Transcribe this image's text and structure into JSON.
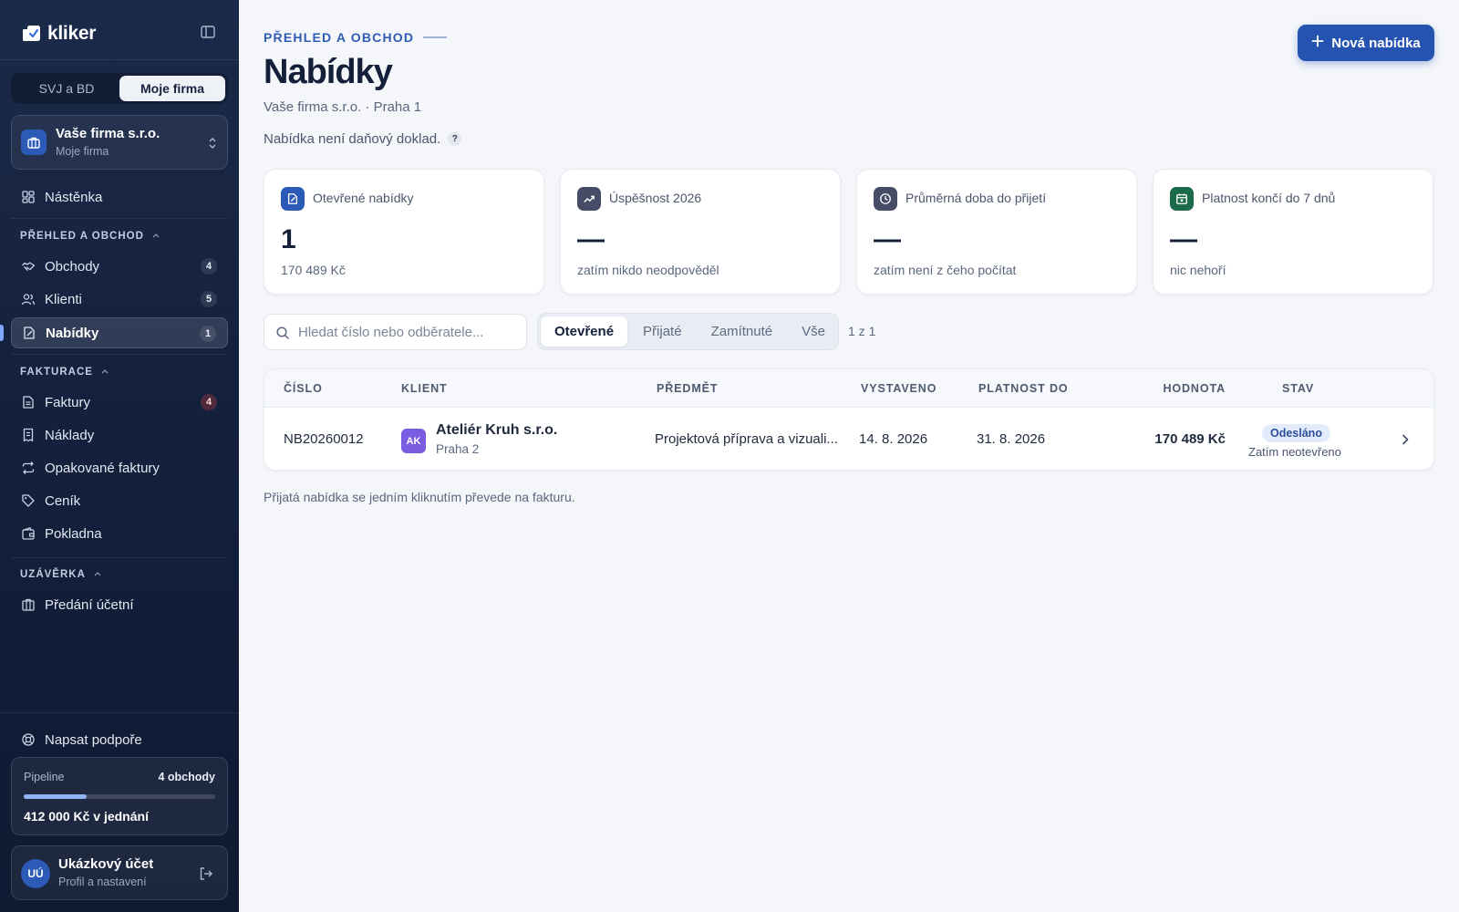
{
  "brand": {
    "name": "kliker"
  },
  "switcher": {
    "options": [
      "SVJ a BD",
      "Moje firma"
    ],
    "active": "Moje firma"
  },
  "company": {
    "name": "Vaše firma s.r.o.",
    "subtitle": "Moje firma"
  },
  "nav": {
    "dashboard": {
      "label": "Nástěnka",
      "icon": "dashboard-icon"
    },
    "section_overview": "PŘEHLED A OBCHOD",
    "deals": {
      "label": "Obchody",
      "count": "4",
      "icon": "handshake-icon"
    },
    "clients": {
      "label": "Klienti",
      "count": "5",
      "icon": "users-icon"
    },
    "offers": {
      "label": "Nabídky",
      "count": "1",
      "icon": "offer-icon"
    },
    "section_invoicing": "FAKTURACE",
    "invoices": {
      "label": "Faktury",
      "count": "4",
      "icon": "invoice-icon"
    },
    "expenses": {
      "label": "Náklady",
      "icon": "receipt-icon"
    },
    "recurring": {
      "label": "Opakované faktury",
      "icon": "repeat-icon"
    },
    "pricelist": {
      "label": "Ceník",
      "icon": "tag-icon"
    },
    "cashbox": {
      "label": "Pokladna",
      "icon": "wallet-icon"
    },
    "section_closing": "UZÁVĚRKA",
    "handover": {
      "label": "Předání účetní",
      "icon": "building-icon"
    }
  },
  "support": {
    "label": "Napsat podpoře"
  },
  "pipeline": {
    "label": "Pipeline",
    "count": "4 obchody",
    "progress": 0.33,
    "value": "412 000 Kč v jednání"
  },
  "account": {
    "initials": "UÚ",
    "name": "Ukázkový účet",
    "subtitle": "Profil a nastavení"
  },
  "header": {
    "eyebrow": "PŘEHLED A OBCHOD",
    "title": "Nabídky",
    "subtitle": "Vaše firma s.r.o. · Praha 1",
    "note": "Nabídka není daňový doklad.",
    "help": "?",
    "new_button": "Nová nabídka"
  },
  "kpis": [
    {
      "label": "Otevřené nabídky",
      "value": "1",
      "sub": "170 489 Kč",
      "color": "#2c5ab7",
      "icon": "offer-icon"
    },
    {
      "label": "Úspěšnost 2026",
      "value": "—",
      "sub": "zatím nikdo neodpověděl",
      "color": "#464c66",
      "icon": "trend-icon"
    },
    {
      "label": "Průměrná doba do přijetí",
      "value": "—",
      "sub": "zatím není z čeho počítat",
      "color": "#464c66",
      "icon": "clock-icon"
    },
    {
      "label": "Platnost končí do 7 dnů",
      "value": "—",
      "sub": "nic nehoří",
      "color": "#1b6b4a",
      "icon": "calendar-icon"
    }
  ],
  "search": {
    "placeholder": "Hledat číslo nebo odběratele..."
  },
  "filters": {
    "tabs": [
      "Otevřené",
      "Přijaté",
      "Zamítnuté",
      "Vše"
    ],
    "active": "Otevřené",
    "pager": "1 z 1"
  },
  "table": {
    "columns": [
      "ČÍSLO",
      "KLIENT",
      "PŘEDMĚT",
      "VYSTAVENO",
      "PLATNOST DO",
      "HODNOTA",
      "STAV"
    ],
    "rows": [
      {
        "number": "NB20260012",
        "client_initials": "AK",
        "client_name": "Ateliér Kruh s.r.o.",
        "client_city": "Praha 2",
        "subject": "Projektová příprava a vizuali...",
        "issued": "14. 8. 2026",
        "valid_until": "31. 8. 2026",
        "value": "170 489 Kč",
        "status": "Odesláno",
        "status_note": "Zatím neotevřeno"
      }
    ]
  },
  "footnote": "Přijatá nabídka se jedním kliknutím převede na fakturu."
}
